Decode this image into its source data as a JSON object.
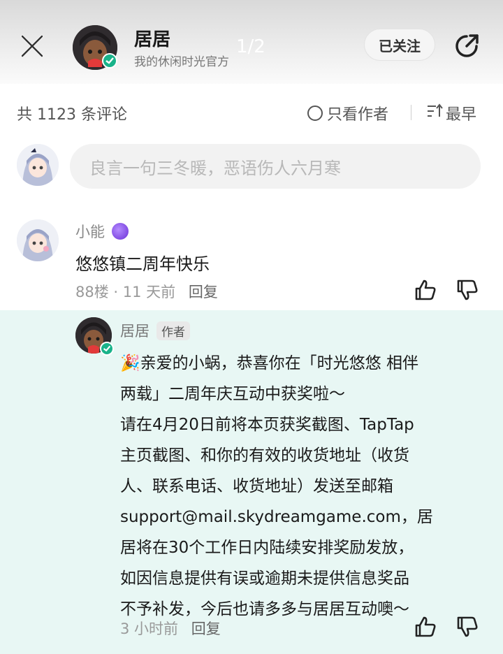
{
  "header": {
    "name": "居居",
    "subtitle": "我的休闲时光官方",
    "page_indicator": "1/2",
    "follow_label": "已关注"
  },
  "comment_bar": {
    "count_text": "共 1123 条评论",
    "author_only_label": "只看作者",
    "sort_label": "最早"
  },
  "input": {
    "placeholder": "良言一句三冬暖，恶语伤人六月寒"
  },
  "comment": {
    "user": "小能",
    "text": "悠悠镇二周年快乐",
    "floor": "88楼",
    "time": "11 天前",
    "reply_label": "回复"
  },
  "reply": {
    "user": "居居",
    "tag": "作者",
    "emoji": "🎉",
    "lines": [
      "亲爱的小蜗，恭喜你在「时光悠悠 相伴",
      "两载」二周年庆互动中获奖啦～",
      "请在4月20日前将本页获奖截图、TapTap",
      "主页截图、和你的有效的收货地址（收货",
      "人、联系电话、收货地址）发送至邮箱",
      "support@mail.skydreamgame.com，居",
      "居将在30个工作日内陆续安排奖励发放，",
      "如因信息提供有误或逾期未提供信息奖品",
      "不予补发，今后也请多多与居居互动噢～"
    ],
    "time": "3 小时前",
    "reply_label": "回复"
  },
  "icons": {
    "close": "close-icon",
    "share": "share-icon",
    "like": "thumbs-up-icon",
    "dislike": "thumbs-down-icon",
    "sort": "sort-icon",
    "verified": "verified-badge-icon"
  },
  "colors": {
    "reply_background": "#e8f7f4",
    "verified_green": "#19b38a",
    "placeholder_text": "#b8b8b8"
  }
}
